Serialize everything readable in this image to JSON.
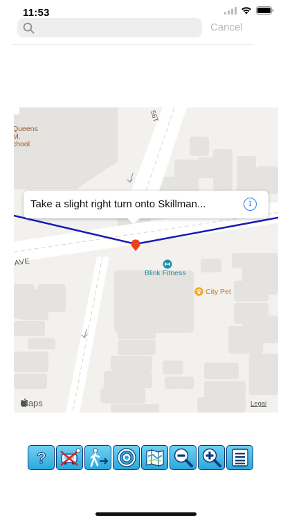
{
  "status_bar": {
    "time": "11:53"
  },
  "search": {
    "placeholder": "",
    "value": "",
    "cancel_label": "Cancel"
  },
  "map": {
    "streets": {
      "ave_label": "AVE",
      "st_label": "56T"
    },
    "pois": {
      "school": "Queens\nM.\nchool",
      "gym": "Blink Fitness",
      "pet": "City Pet"
    },
    "callout": {
      "text": "Take a slight right turn onto Skillman..."
    },
    "brand": "Maps",
    "legal": "Legal",
    "colors": {
      "route": "#1a1ab8",
      "pin": "#f0401c",
      "poi_teal": "#1e8ea8",
      "poi_orange": "#f6a623",
      "school": "#9a5a2a"
    }
  },
  "toolbar": {
    "buttons": [
      {
        "name": "help",
        "icon": "help-icon"
      },
      {
        "name": "no-vehicle",
        "icon": "no-vehicle-icon"
      },
      {
        "name": "walk",
        "icon": "walk-icon"
      },
      {
        "name": "target",
        "icon": "target-icon"
      },
      {
        "name": "map",
        "icon": "map-icon"
      },
      {
        "name": "zoom-out",
        "icon": "zoom-out-icon"
      },
      {
        "name": "zoom-in",
        "icon": "zoom-in-icon"
      },
      {
        "name": "list",
        "icon": "list-icon"
      }
    ],
    "colors": {
      "fill": "#3ab4e4",
      "border": "#0b3c75"
    }
  }
}
